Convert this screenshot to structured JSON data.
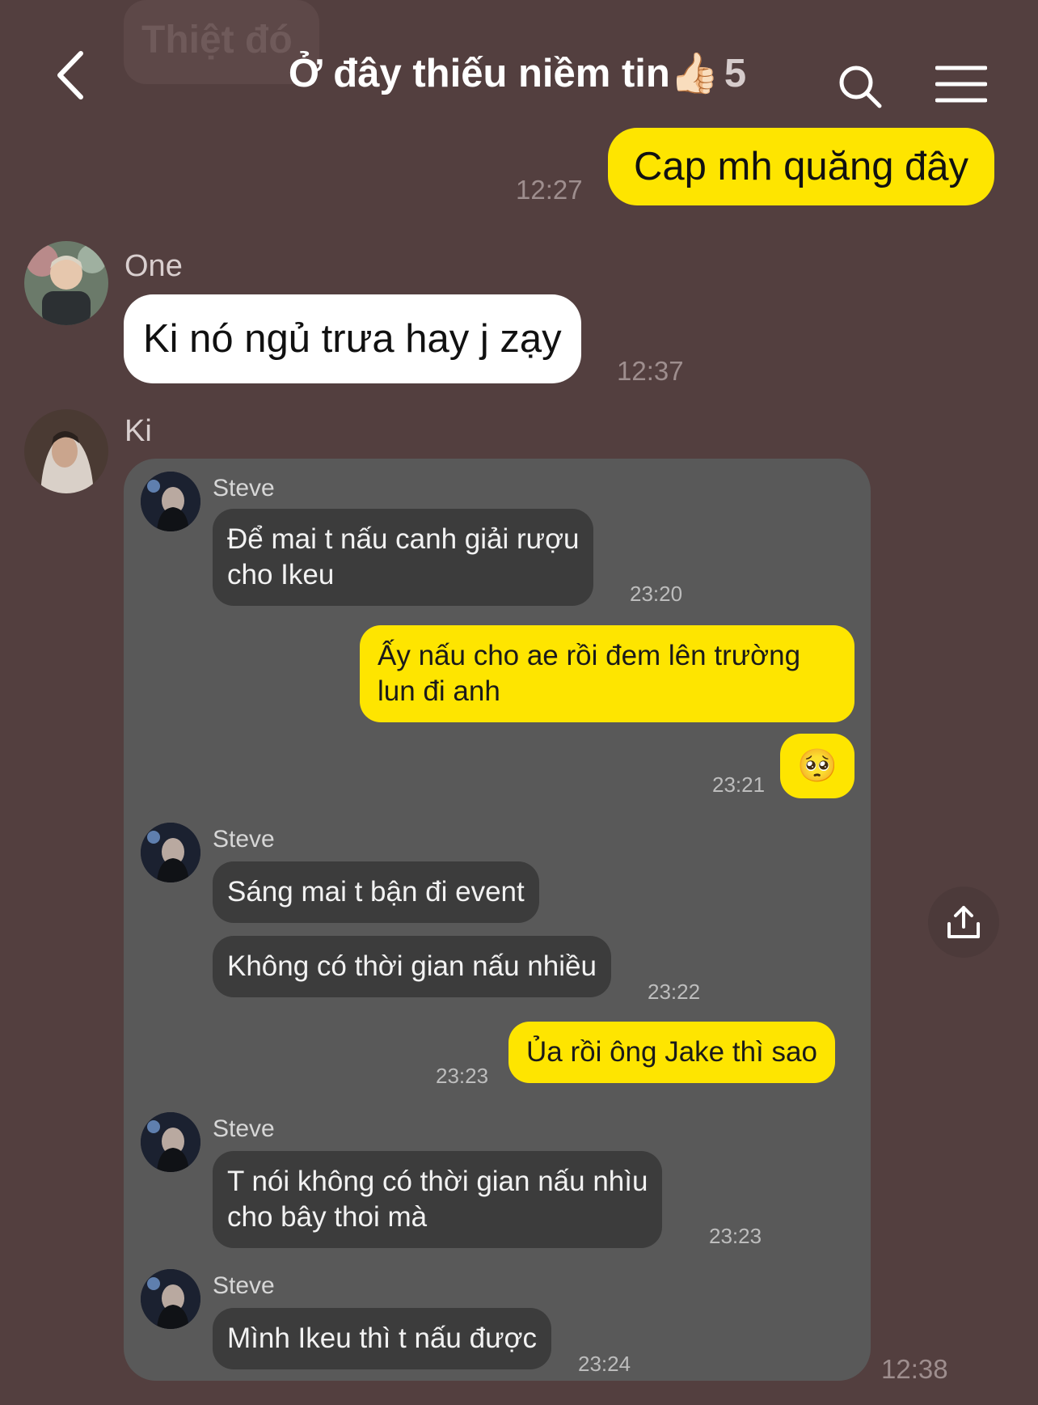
{
  "header": {
    "ghost_text": "Thiệt đó",
    "title": "Ở đây thiếu niềm tin👍🏻",
    "member_count": "5",
    "icons": {
      "back": "back-arrow-icon",
      "search": "search-icon",
      "menu": "hamburger-menu-icon"
    }
  },
  "messages": {
    "m1": {
      "text": "Cap mh quăng đây",
      "time": "12:27"
    },
    "m2": {
      "sender": "One",
      "text": "Ki nó ngủ trưa hay j zạy",
      "time": "12:37"
    },
    "m3": {
      "sender": "Ki",
      "time": "12:38"
    }
  },
  "screenshot": {
    "g1": {
      "sender": "Steve",
      "line1": "Để mai t nấu canh giải rượu",
      "line2": "cho Ikeu",
      "time": "23:20"
    },
    "g2": {
      "line1": "Ấy nấu cho ae rồi đem lên trường",
      "line2": "lun đi anh",
      "emoji": "🥺",
      "time": "23:21"
    },
    "g3": {
      "sender": "Steve",
      "msg1": "Sáng mai t bận đi event",
      "msg2": "Không có thời gian nấu nhiều",
      "time": "23:22"
    },
    "g4": {
      "text": "Ủa rồi ông Jake thì sao",
      "time": "23:23"
    },
    "g5": {
      "sender": "Steve",
      "line1": "T nói không có thời gian nấu nhìu",
      "line2": "cho bây thoi mà",
      "time": "23:23"
    },
    "g6": {
      "sender": "Steve",
      "text": "Mình Ikeu thì t nấu được",
      "time": "23:24"
    }
  },
  "colors": {
    "background": "#533f3f",
    "my_bubble": "#fee500",
    "their_bubble": "#ffffff",
    "card": "#595959",
    "card_bubble": "#3c3c3c"
  }
}
